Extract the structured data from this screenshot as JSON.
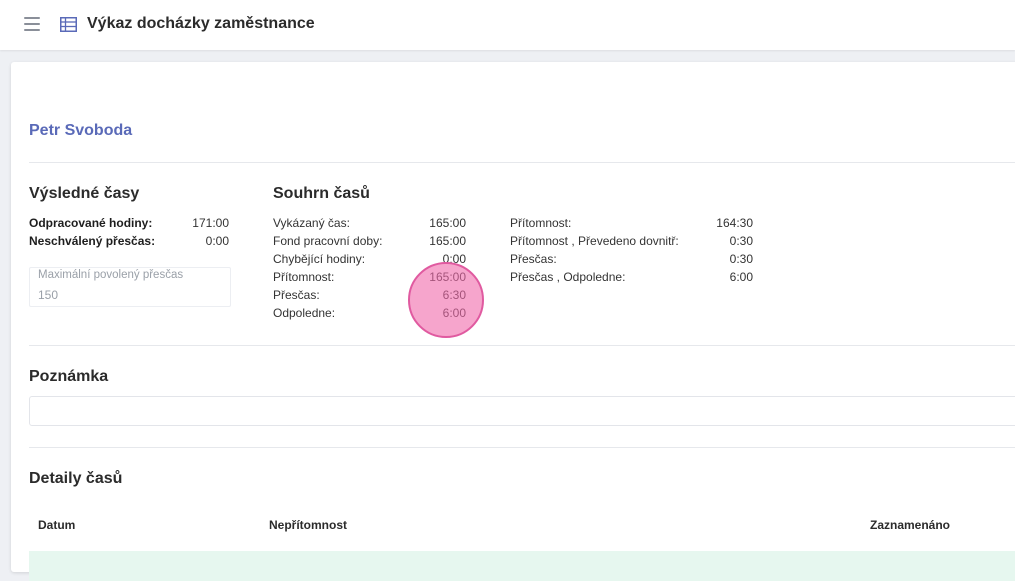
{
  "header": {
    "menu_icon": "hamburger-menu-icon",
    "table_icon": "table-icon",
    "title": "Výkaz docházky zaměstnance"
  },
  "employee": {
    "name": "Petr Svoboda"
  },
  "vysledne_casy": {
    "heading": "Výsledné časy",
    "rows": [
      {
        "label": "Odpracované hodiny:",
        "value": "171:00"
      },
      {
        "label": "Neschválený přesčas:",
        "value": "0:00"
      }
    ],
    "max_overtime": {
      "label": "Maximální povolený přesčas",
      "value": "150"
    }
  },
  "souhrn_casu": {
    "heading": "Souhrn časů",
    "left_rows": [
      {
        "label": "Vykázaný čas:",
        "value": "165:00"
      },
      {
        "label": "Fond pracovní doby:",
        "value": "165:00"
      },
      {
        "label": "Chybějící hodiny:",
        "value": "0:00"
      },
      {
        "label": "Přítomnost:",
        "value": "165:00"
      },
      {
        "label": "Přesčas:",
        "value": "6:30"
      },
      {
        "label": "Odpoledne:",
        "value": "6:00"
      }
    ],
    "right_rows": [
      {
        "label": "Přítomnost:",
        "value": "164:30"
      },
      {
        "label": "Přítomnost , Převedeno dovnitř:",
        "value": "0:30"
      },
      {
        "label": "Přesčas:",
        "value": "0:30"
      },
      {
        "label": "Přesčas , Odpoledne:",
        "value": "6:00"
      }
    ]
  },
  "poznamka": {
    "heading": "Poznámka",
    "value": ""
  },
  "detaily": {
    "heading": "Detaily časů",
    "columns": [
      "Datum",
      "Nepřítomnost",
      "Zaznamenáno"
    ]
  },
  "colors": {
    "accent": "#5a6ab8",
    "highlight_row": "#e6f7ef",
    "pointer": "#f069aa"
  }
}
